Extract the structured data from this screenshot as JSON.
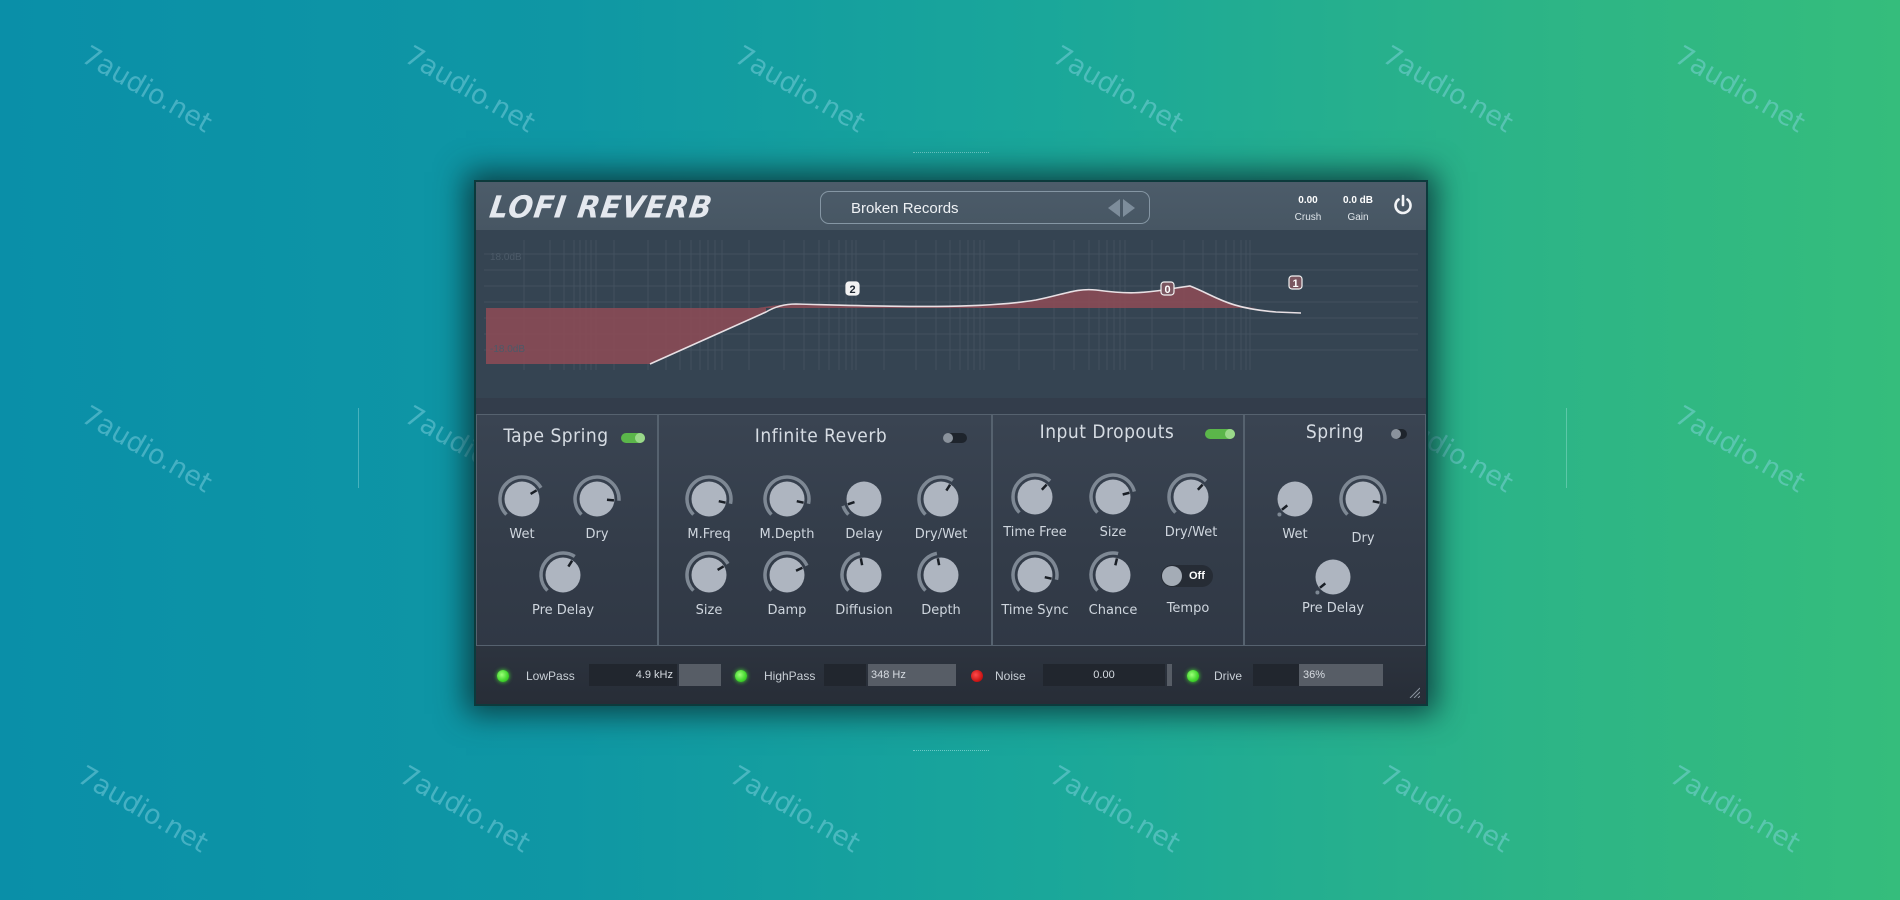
{
  "watermark": "7audio.net",
  "plugin": {
    "title": "LOFI REVERB",
    "preset": {
      "name": "Broken Records",
      "prev_icon": "triangle-left",
      "next_icon": "triangle-right"
    },
    "crush": {
      "value": "0.00",
      "label": "Crush"
    },
    "gain": {
      "value": "0.0 dB",
      "label": "Gain"
    },
    "power_icon": "power-icon"
  },
  "eq": {
    "db_top": "18.0dB",
    "db_bottom": "-18.0dB",
    "nodes": [
      {
        "id": "2",
        "label": "2"
      },
      {
        "id": "0",
        "label": "0"
      },
      {
        "id": "1",
        "label": "1"
      }
    ],
    "colors": {
      "fill": "#8a4b55",
      "curve": "#e8e0e4",
      "bg": "#354452"
    }
  },
  "modules": {
    "tape_spring": {
      "title": "Tape Spring",
      "enabled": true,
      "knobs": [
        {
          "label": "Wet",
          "value": 0.72
        },
        {
          "label": "Dry",
          "value": 0.85
        },
        {
          "label": "Pre Delay",
          "value": 0.62
        }
      ]
    },
    "infinite_reverb": {
      "title": "Infinite Reverb",
      "enabled": false,
      "knobs": [
        {
          "label": "M.Freq",
          "value": 0.88
        },
        {
          "label": "M.Depth",
          "value": 0.88
        },
        {
          "label": "Delay",
          "value": 0.1
        },
        {
          "label": "Dry/Wet",
          "value": 0.62
        },
        {
          "label": "Size",
          "value": 0.72
        },
        {
          "label": "Damp",
          "value": 0.74
        },
        {
          "label": "Diffusion",
          "value": 0.46
        },
        {
          "label": "Depth",
          "value": 0.46
        }
      ]
    },
    "input_dropouts": {
      "title": "Input Dropouts",
      "enabled": true,
      "knobs": [
        {
          "label": "Time Free",
          "value": 0.66
        },
        {
          "label": "Size",
          "value": 0.78
        },
        {
          "label": "Dry/Wet",
          "value": 0.66
        },
        {
          "label": "Time Sync",
          "value": 0.88
        },
        {
          "label": "Chance",
          "value": 0.55
        }
      ],
      "tempo": {
        "label": "Tempo",
        "state": "Off"
      }
    },
    "spring": {
      "title": "Spring",
      "enabled": false,
      "knobs": [
        {
          "label": "Wet",
          "value": 0.02
        },
        {
          "label": "Dry",
          "value": 0.88
        },
        {
          "label": "Pre Delay",
          "value": 0.02
        }
      ]
    }
  },
  "footer": {
    "lowpass": {
      "label": "LowPass",
      "value": "4.9 kHz",
      "enabled": true,
      "fraction": 0.7
    },
    "highpass": {
      "label": "HighPass",
      "value": "348 Hz",
      "enabled": true,
      "fraction": 0.1
    },
    "noise": {
      "label": "Noise",
      "value": "0.00",
      "enabled": false,
      "fraction": 0.0
    },
    "drive": {
      "label": "Drive",
      "value": "36%",
      "enabled": true,
      "fraction": 0.36
    }
  },
  "accent_colors": {
    "led_on": "#3fd52b",
    "led_off": "#c81414",
    "toggle_on": "#5bb64a"
  }
}
